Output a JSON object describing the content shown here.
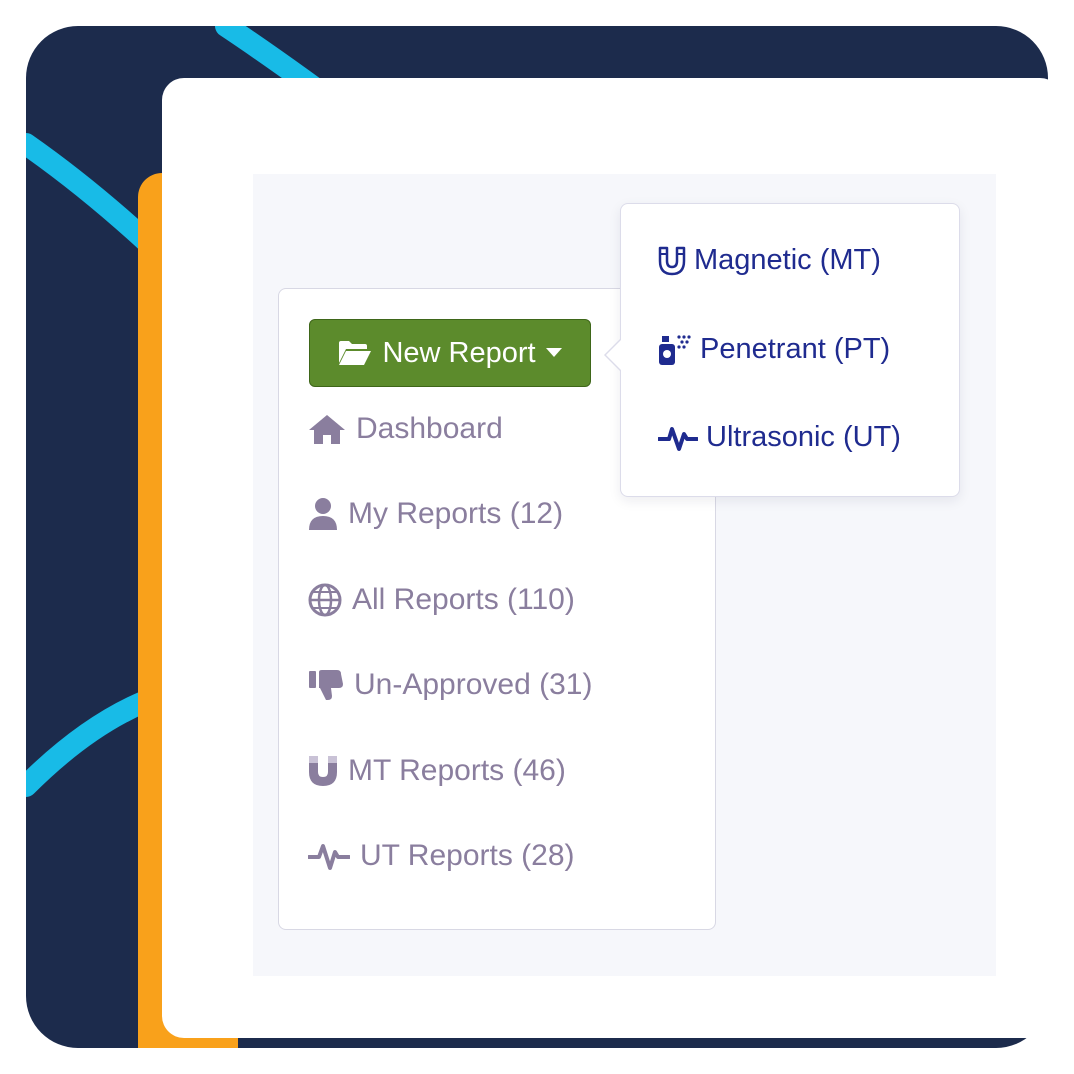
{
  "colors": {
    "navy": "#1c2b4c",
    "cyan_stroke": "#18c3ef",
    "orange": "#f9a11b",
    "button_green": "#5c8b2c",
    "menu_text": "#8a7e9e",
    "dropdown_text": "#1f2b8f"
  },
  "new_report": {
    "label": "New Report",
    "icon": "folder-open-icon",
    "caret_icon": "caret-down-icon"
  },
  "nav": {
    "dashboard": {
      "label": "Dashboard",
      "icon": "home-icon"
    },
    "my_reports": {
      "label": "My Reports (12)",
      "icon": "user-icon"
    },
    "all_reports": {
      "label": "All Reports (110)",
      "icon": "globe-icon"
    },
    "unapproved": {
      "label": "Un-Approved (31)",
      "icon": "thumbs-down-icon"
    },
    "mt_reports": {
      "label": "MT Reports (46)",
      "icon": "magnet-icon"
    },
    "ut_reports": {
      "label": "UT Reports (28)",
      "icon": "pulse-icon"
    }
  },
  "dropdown": {
    "magnetic": {
      "label": "Magnetic (MT)",
      "icon": "magnet-icon"
    },
    "penetrant": {
      "label": "Penetrant (PT)",
      "icon": "spray-can-icon"
    },
    "ultrasonic": {
      "label": "Ultrasonic (UT)",
      "icon": "pulse-icon"
    }
  }
}
